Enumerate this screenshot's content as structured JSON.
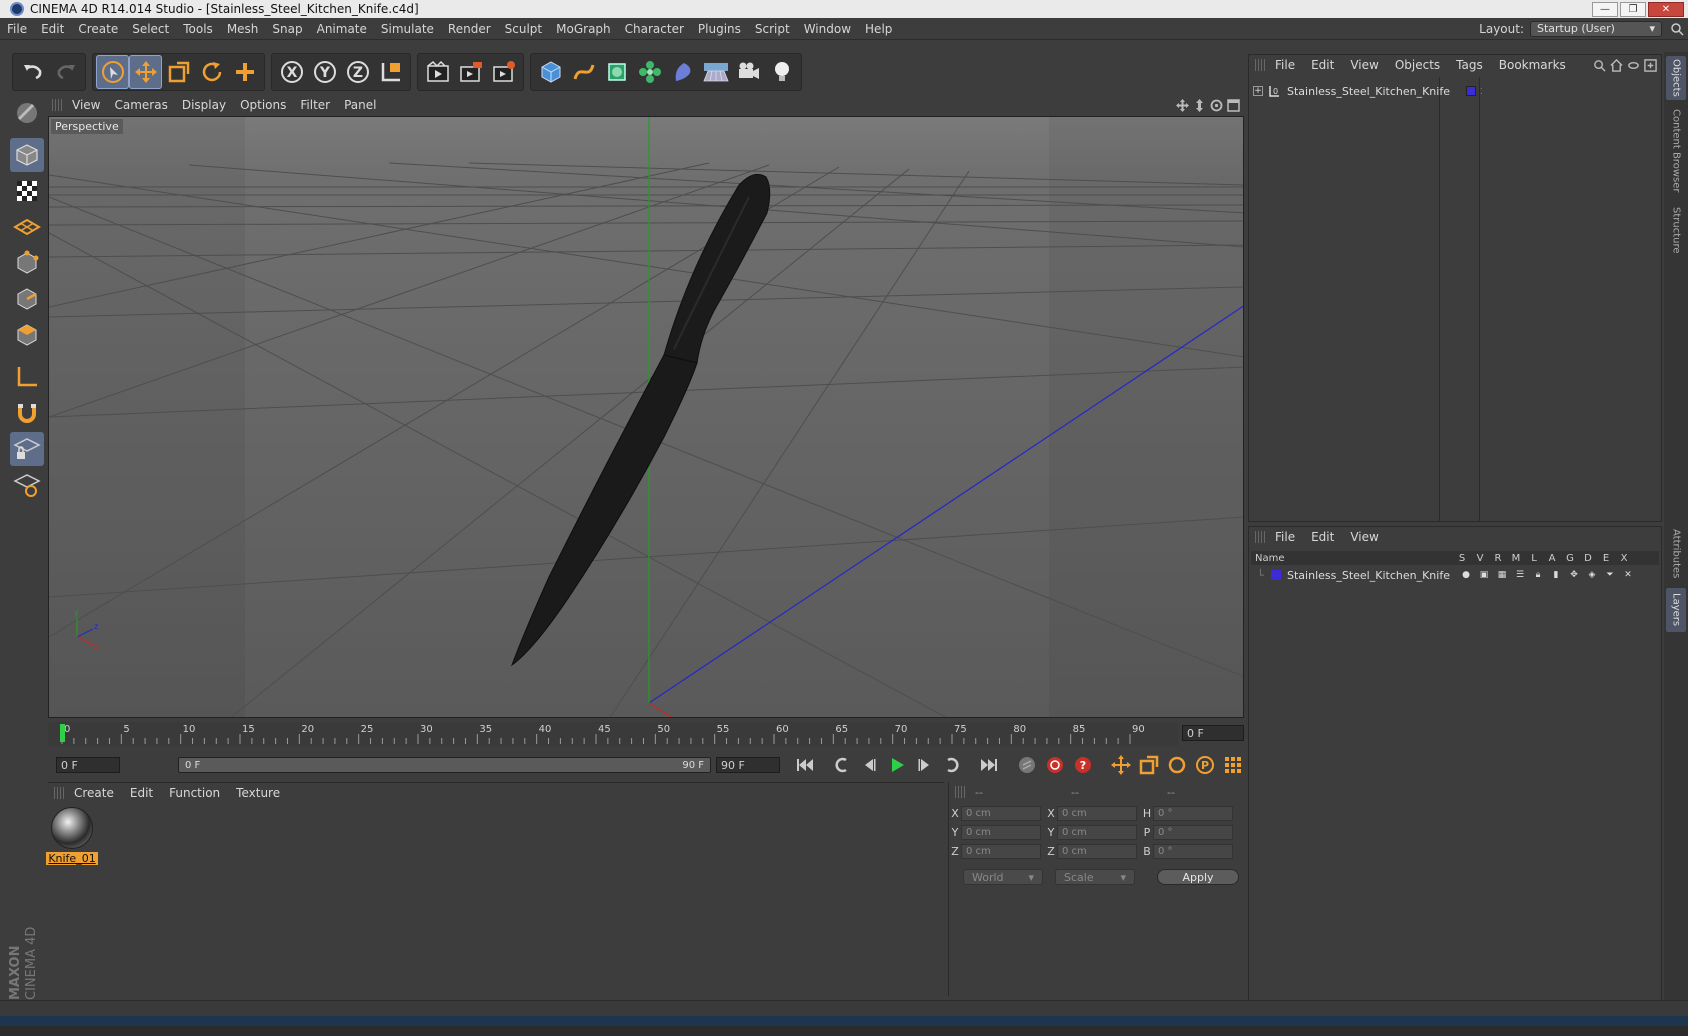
{
  "window": {
    "title": "CINEMA 4D R14.014 Studio - [Stainless_Steel_Kitchen_Knife.c4d]",
    "minimize": "—",
    "maximize": "❐",
    "close": "✕"
  },
  "menu": {
    "items": [
      "File",
      "Edit",
      "Create",
      "Select",
      "Tools",
      "Mesh",
      "Snap",
      "Animate",
      "Simulate",
      "Render",
      "Sculpt",
      "MoGraph",
      "Character",
      "Plugins",
      "Script",
      "Window",
      "Help"
    ],
    "layout_label": "Layout:",
    "layout_value": "Startup (User)"
  },
  "viewport": {
    "menu": [
      "View",
      "Cameras",
      "Display",
      "Options",
      "Filter",
      "Panel"
    ],
    "camera_label": "Perspective"
  },
  "timeline": {
    "ticks": [
      "0",
      "5",
      "10",
      "15",
      "20",
      "25",
      "30",
      "35",
      "40",
      "45",
      "50",
      "55",
      "60",
      "65",
      "70",
      "75",
      "80",
      "85",
      "90"
    ],
    "current_frame": "0 F",
    "start_field": "0 F",
    "range_start": "0 F",
    "range_end": "90 F",
    "end_field": "90 F"
  },
  "materials": {
    "menu": [
      "Create",
      "Edit",
      "Function",
      "Texture"
    ],
    "items": [
      {
        "name": "Knife_01"
      }
    ]
  },
  "coordinates": {
    "headers": [
      "--",
      "--",
      "--"
    ],
    "rows": [
      {
        "a1": "X",
        "v1": "0 cm",
        "a2": "X",
        "v2": "0 cm",
        "a3": "H",
        "v3": "0 °"
      },
      {
        "a1": "Y",
        "v1": "0 cm",
        "a2": "Y",
        "v2": "0 cm",
        "a3": "P",
        "v3": "0 °"
      },
      {
        "a1": "Z",
        "v1": "0 cm",
        "a2": "Z",
        "v2": "0 cm",
        "a3": "B",
        "v3": "0 °"
      }
    ],
    "space_select": "World",
    "mode_select": "Scale",
    "apply": "Apply"
  },
  "objects": {
    "menu": [
      "File",
      "Edit",
      "View",
      "Objects",
      "Tags",
      "Bookmarks"
    ],
    "items": [
      {
        "name": "Stainless_Steel_Kitchen_Knife",
        "tag_color": "#3b2bd8"
      }
    ]
  },
  "layers": {
    "menu": [
      "File",
      "Edit",
      "View"
    ],
    "columns": [
      "Name",
      "S",
      "V",
      "R",
      "M",
      "L",
      "A",
      "G",
      "D",
      "E",
      "X"
    ],
    "items": [
      {
        "name": "Stainless_Steel_Kitchen_Knife",
        "color": "#3b2bd8"
      }
    ]
  },
  "side_tabs": [
    "Objects",
    "Content Browser",
    "Structure",
    "Attributes",
    "Layers"
  ],
  "logo": {
    "line1": "MAXON",
    "line2": "CINEMA 4D"
  },
  "colors": {
    "accent": "#5e6e8a",
    "orange_icon": "#f0a030",
    "viewport_bg": "#6b6b6b",
    "y_axis": "#1fa01f",
    "z_axis": "#2626c8"
  }
}
